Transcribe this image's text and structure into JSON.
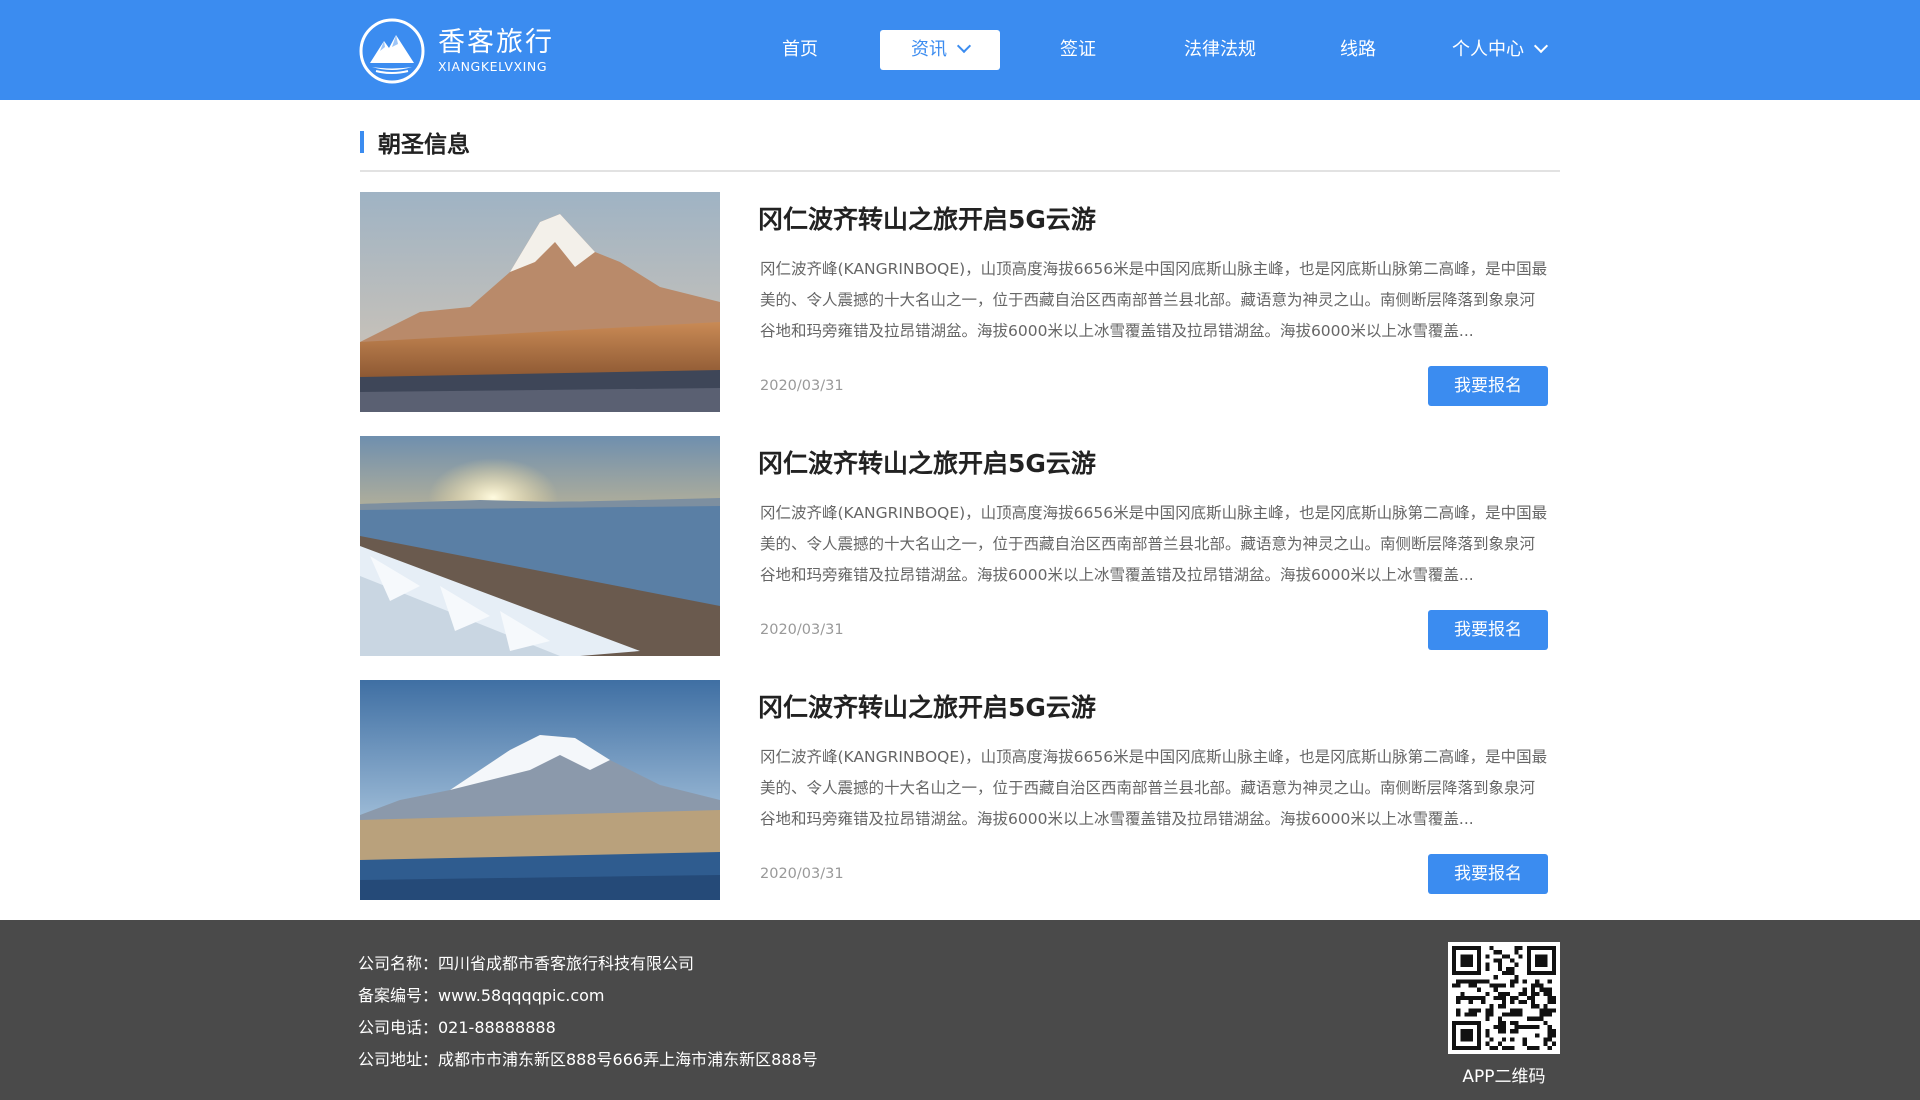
{
  "brand": {
    "name_cn": "香客旅行",
    "name_en": "XIANGKELVXING",
    "logo_icon": "mountain-logo-icon",
    "primary_color": "#3b8cf0"
  },
  "nav": {
    "items": [
      {
        "label": "首页",
        "has_dropdown": false,
        "active": false
      },
      {
        "label": "资讯",
        "has_dropdown": true,
        "active": true
      },
      {
        "label": "签证",
        "has_dropdown": false,
        "active": false
      },
      {
        "label": "法律法规",
        "has_dropdown": false,
        "active": false
      },
      {
        "label": "线路",
        "has_dropdown": false,
        "active": false
      },
      {
        "label": "个人中心",
        "has_dropdown": true,
        "active": false
      }
    ]
  },
  "section": {
    "title": "朝圣信息"
  },
  "articles": [
    {
      "title": "冈仁波齐转山之旅开启5G云游",
      "description": "冈仁波齐峰(KANGRINBOQE)，山顶高度海拔6656米是中国冈底斯山脉主峰，也是冈底斯山脉第二高峰，是中国最美的、令人震撼的十大名山之一，位于西藏自治区西南部普兰县北部。藏语意为神灵之山。南侧断层降落到象泉河谷地和玛旁雍错及拉昂错湖盆。海拔6000米以上冰雪覆盖错及拉昂错湖盆。海拔6000米以上冰雪覆盖...",
      "date": "2020/03/31",
      "button_label": "我要报名"
    },
    {
      "title": "冈仁波齐转山之旅开启5G云游",
      "description": "冈仁波齐峰(KANGRINBOQE)，山顶高度海拔6656米是中国冈底斯山脉主峰，也是冈底斯山脉第二高峰，是中国最美的、令人震撼的十大名山之一，位于西藏自治区西南部普兰县北部。藏语意为神灵之山。南侧断层降落到象泉河谷地和玛旁雍错及拉昂错湖盆。海拔6000米以上冰雪覆盖错及拉昂错湖盆。海拔6000米以上冰雪覆盖...",
      "date": "2020/03/31",
      "button_label": "我要报名"
    },
    {
      "title": "冈仁波齐转山之旅开启5G云游",
      "description": "冈仁波齐峰(KANGRINBOQE)，山顶高度海拔6656米是中国冈底斯山脉主峰，也是冈底斯山脉第二高峰，是中国最美的、令人震撼的十大名山之一，位于西藏自治区西南部普兰县北部。藏语意为神灵之山。南侧断层降落到象泉河谷地和玛旁雍错及拉昂错湖盆。海拔6000米以上冰雪覆盖错及拉昂错湖盆。海拔6000米以上冰雪覆盖...",
      "date": "2020/03/31",
      "button_label": "我要报名"
    }
  ],
  "footer": {
    "company_name": "公司名称：四川省成都市香客旅行科技有限公司",
    "record_number": "备案编号：www.58qqqqpic.com",
    "phone": "公司电话：021-88888888",
    "address": "公司地址：成都市市浦东新区888号666弄上海市浦东新区888号",
    "qr_label": "APP二维码"
  }
}
